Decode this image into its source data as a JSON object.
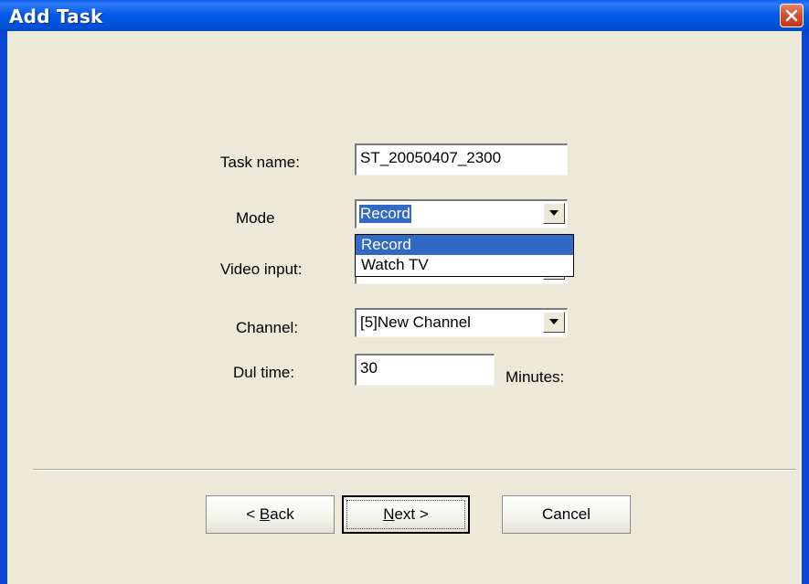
{
  "window": {
    "title": "Add Task"
  },
  "form": {
    "task_name_label": "Task name:",
    "task_name_value": "ST_20050407_2300",
    "mode_label": "Mode",
    "mode_value": "Record",
    "mode_options": [
      "Record",
      "Watch TV"
    ],
    "video_input_label": "Video input:",
    "channel_label": "Channel:",
    "channel_value": "[5]New Channel",
    "duration_label": "Dul time:",
    "duration_value": "30",
    "duration_unit": "Minutes:"
  },
  "buttons": {
    "back": {
      "prefix": "< ",
      "mnemonic": "B",
      "rest": "ack"
    },
    "next": {
      "mnemonic": "N",
      "rest": "ext >"
    },
    "cancel": "Cancel"
  },
  "colors": {
    "titlebar": "#0058e6",
    "selection": "#316ac5",
    "dialog_bg": "#ece9d8",
    "close_button": "#d34f2c"
  },
  "icons": {
    "close": "close-icon",
    "dropdown": "chevron-down-icon"
  }
}
